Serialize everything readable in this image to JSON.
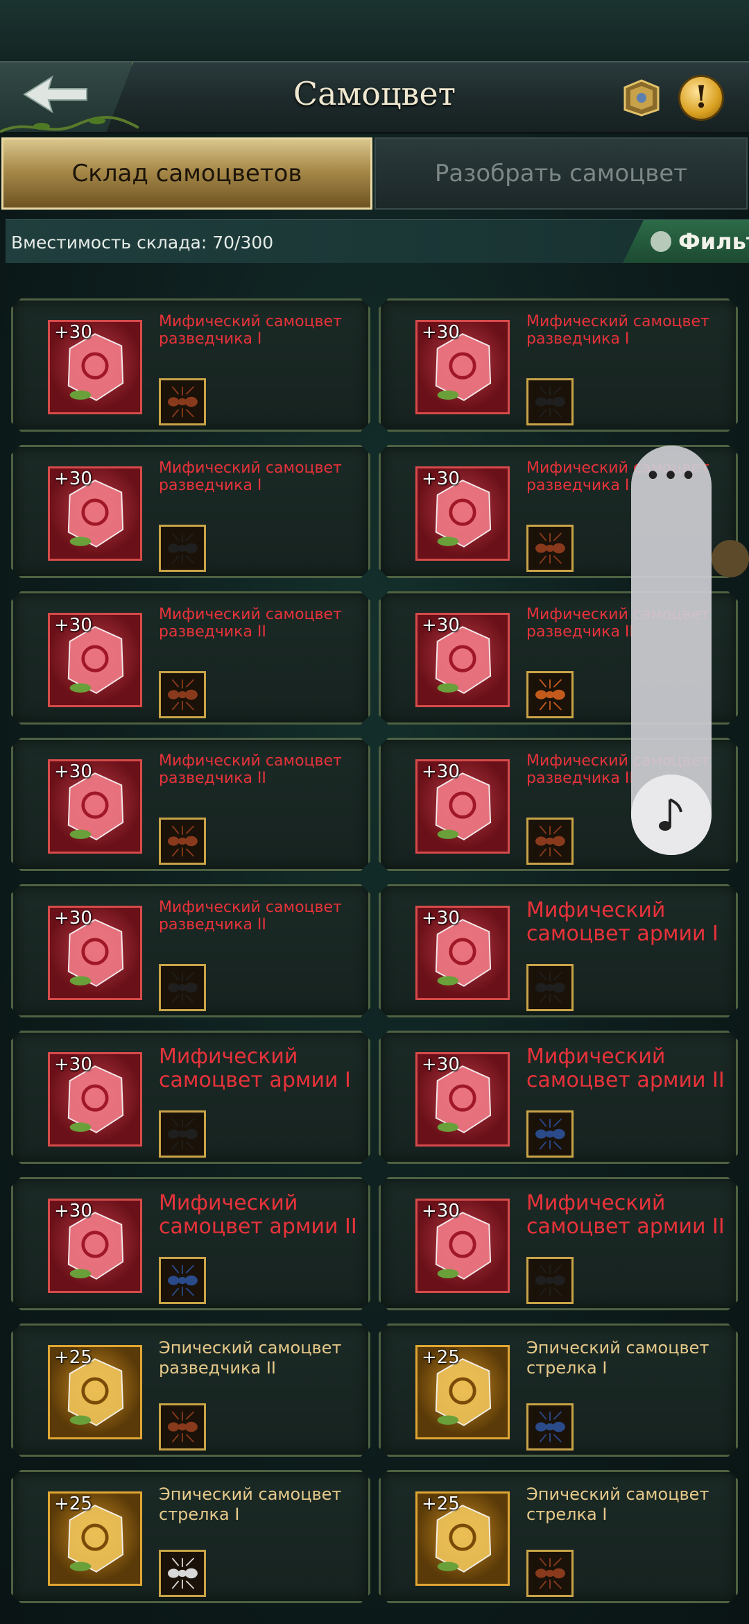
{
  "header": {
    "title": "Самоцвет"
  },
  "tabs": [
    {
      "label": "Склад самоцветов",
      "active": true
    },
    {
      "label": "Разобрать самоцвет",
      "active": false
    }
  ],
  "capacity": {
    "text": "Вместимость склада: 70/300"
  },
  "filter": {
    "label": "Фильт"
  },
  "items": [
    {
      "level": "+30",
      "name": "Мифический самоцвет разведчика I",
      "rarity": "mythic",
      "ant": "red-ant"
    },
    {
      "level": "+30",
      "name": "Мифический самоцвет разведчика I",
      "rarity": "mythic",
      "ant": "black-ant"
    },
    {
      "level": "+30",
      "name": "Мифический самоцвет разведчика I",
      "rarity": "mythic",
      "ant": "black-ant"
    },
    {
      "level": "+30",
      "name": "Мифический самоцвет разведчика I",
      "rarity": "mythic",
      "ant": "red-ant"
    },
    {
      "level": "+30",
      "name": "Мифический самоцвет разведчика II",
      "rarity": "mythic",
      "ant": "red-ant"
    },
    {
      "level": "+30",
      "name": "Мифический самоцвет разведчика II",
      "rarity": "mythic",
      "ant": "orange-ant"
    },
    {
      "level": "+30",
      "name": "Мифический самоцвет разведчика II",
      "rarity": "mythic",
      "ant": "red-ant"
    },
    {
      "level": "+30",
      "name": "Мифический самоцвет разведчика II",
      "rarity": "mythic",
      "ant": "red-ant"
    },
    {
      "level": "+30",
      "name": "Мифический самоцвет разведчика II",
      "rarity": "mythic",
      "ant": "black-ant"
    },
    {
      "level": "+30",
      "name": "Мифический самоцвет армии I",
      "rarity": "mythic",
      "ant": "black-ant"
    },
    {
      "level": "+30",
      "name": "Мифический самоцвет армии I",
      "rarity": "mythic",
      "ant": "black-ant"
    },
    {
      "level": "+30",
      "name": "Мифический самоцвет армии II",
      "rarity": "mythic",
      "ant": "blue-ant"
    },
    {
      "level": "+30",
      "name": "Мифический самоцвет армии II",
      "rarity": "mythic",
      "ant": "blue-ant"
    },
    {
      "level": "+30",
      "name": "Мифический самоцвет армии II",
      "rarity": "mythic",
      "ant": "black-ant"
    },
    {
      "level": "+25",
      "name": "Эпический самоцвет разведчика II",
      "rarity": "epic",
      "ant": "red-ant"
    },
    {
      "level": "+25",
      "name": "Эпический самоцвет стрелка I",
      "rarity": "epic",
      "ant": "blue-ant"
    },
    {
      "level": "+25",
      "name": "Эпический самоцвет стрелка I",
      "rarity": "epic",
      "ant": "white-ant"
    },
    {
      "level": "+25",
      "name": "Эпический самоцвет стрелка I",
      "rarity": "epic",
      "ant": "red-ant"
    }
  ],
  "widget": {
    "icons": [
      "more-icon",
      "music-note-icon"
    ]
  },
  "colors": {
    "mythic_text": "#e8323a",
    "epic_text": "#e6c98a",
    "tab_active": "#c9b27a"
  }
}
